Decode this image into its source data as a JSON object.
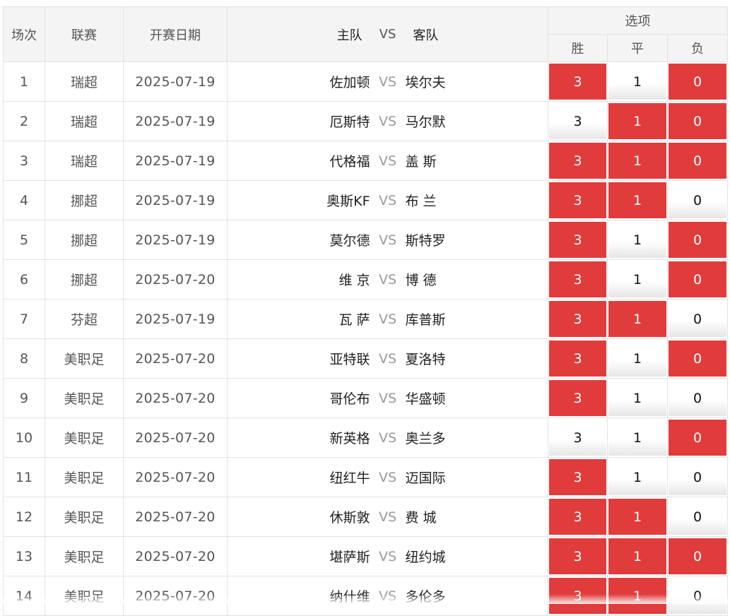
{
  "header": {
    "col_idx": "场次",
    "col_league": "联赛",
    "col_date": "开赛日期",
    "col_home": "主队",
    "col_vs": "VS",
    "col_away": "客队",
    "col_options": "选项",
    "opt_win": "胜",
    "opt_draw": "平",
    "opt_lose": "负"
  },
  "colors": {
    "selected": "#e03c3c",
    "header_bg": "#f4f4f4",
    "border": "#e3e3e3"
  },
  "rows": [
    {
      "idx": "1",
      "league": "瑞超",
      "date": "2025-07-19",
      "home": "佐加顿",
      "vs": "VS",
      "away": "埃尔夫",
      "win": "3",
      "draw": "1",
      "lose": "0",
      "win_sel": true,
      "draw_sel": false,
      "lose_sel": true
    },
    {
      "idx": "2",
      "league": "瑞超",
      "date": "2025-07-19",
      "home": "厄斯特",
      "vs": "VS",
      "away": "马尔默",
      "win": "3",
      "draw": "1",
      "lose": "0",
      "win_sel": false,
      "draw_sel": true,
      "lose_sel": true
    },
    {
      "idx": "3",
      "league": "瑞超",
      "date": "2025-07-19",
      "home": "代格福",
      "vs": "VS",
      "away": "盖 斯",
      "win": "3",
      "draw": "1",
      "lose": "0",
      "win_sel": true,
      "draw_sel": true,
      "lose_sel": true
    },
    {
      "idx": "4",
      "league": "挪超",
      "date": "2025-07-19",
      "home": "奥斯KF",
      "vs": "VS",
      "away": "布 兰",
      "win": "3",
      "draw": "1",
      "lose": "0",
      "win_sel": true,
      "draw_sel": true,
      "lose_sel": false
    },
    {
      "idx": "5",
      "league": "挪超",
      "date": "2025-07-19",
      "home": "莫尔德",
      "vs": "VS",
      "away": "斯特罗",
      "win": "3",
      "draw": "1",
      "lose": "0",
      "win_sel": true,
      "draw_sel": false,
      "lose_sel": true
    },
    {
      "idx": "6",
      "league": "挪超",
      "date": "2025-07-20",
      "home": "维 京",
      "vs": "VS",
      "away": "博 德",
      "win": "3",
      "draw": "1",
      "lose": "0",
      "win_sel": true,
      "draw_sel": false,
      "lose_sel": true
    },
    {
      "idx": "7",
      "league": "芬超",
      "date": "2025-07-19",
      "home": "瓦 萨",
      "vs": "VS",
      "away": "库普斯",
      "win": "3",
      "draw": "1",
      "lose": "0",
      "win_sel": true,
      "draw_sel": true,
      "lose_sel": false
    },
    {
      "idx": "8",
      "league": "美职足",
      "date": "2025-07-20",
      "home": "亚特联",
      "vs": "VS",
      "away": "夏洛特",
      "win": "3",
      "draw": "1",
      "lose": "0",
      "win_sel": true,
      "draw_sel": false,
      "lose_sel": true
    },
    {
      "idx": "9",
      "league": "美职足",
      "date": "2025-07-20",
      "home": "哥伦布",
      "vs": "VS",
      "away": "华盛顿",
      "win": "3",
      "draw": "1",
      "lose": "0",
      "win_sel": true,
      "draw_sel": false,
      "lose_sel": false
    },
    {
      "idx": "10",
      "league": "美职足",
      "date": "2025-07-20",
      "home": "新英格",
      "vs": "VS",
      "away": "奥兰多",
      "win": "3",
      "draw": "1",
      "lose": "0",
      "win_sel": false,
      "draw_sel": false,
      "lose_sel": true
    },
    {
      "idx": "11",
      "league": "美职足",
      "date": "2025-07-20",
      "home": "纽红牛",
      "vs": "VS",
      "away": "迈国际",
      "win": "3",
      "draw": "1",
      "lose": "0",
      "win_sel": true,
      "draw_sel": false,
      "lose_sel": false
    },
    {
      "idx": "12",
      "league": "美职足",
      "date": "2025-07-20",
      "home": "休斯敦",
      "vs": "VS",
      "away": "费 城",
      "win": "3",
      "draw": "1",
      "lose": "0",
      "win_sel": true,
      "draw_sel": true,
      "lose_sel": false
    },
    {
      "idx": "13",
      "league": "美职足",
      "date": "2025-07-20",
      "home": "堪萨斯",
      "vs": "VS",
      "away": "纽约城",
      "win": "3",
      "draw": "1",
      "lose": "0",
      "win_sel": true,
      "draw_sel": true,
      "lose_sel": true
    },
    {
      "idx": "14",
      "league": "美职足",
      "date": "2025-07-20",
      "home": "纳什维",
      "vs": "VS",
      "away": "多伦多",
      "win": "3",
      "draw": "1",
      "lose": "0",
      "win_sel": true,
      "draw_sel": true,
      "lose_sel": false
    }
  ]
}
